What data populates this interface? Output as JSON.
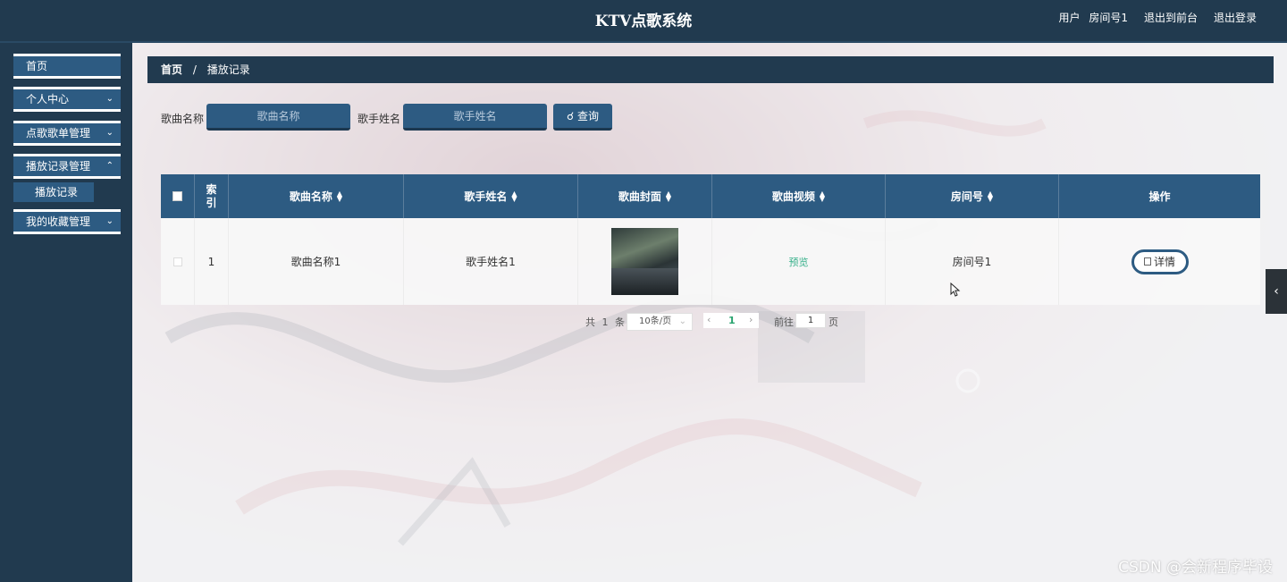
{
  "header": {
    "title": "KTV点歌系统",
    "user_label": "用户",
    "user_name": "房间号1",
    "front_link": "退出到前台",
    "logout_link": "退出登录"
  },
  "sidebar": {
    "items": [
      {
        "label": "首页"
      },
      {
        "label": "个人中心"
      },
      {
        "label": "点歌歌单管理"
      },
      {
        "label": "播放记录管理"
      },
      {
        "label": "我的收藏管理"
      }
    ],
    "subitem": {
      "label": "播放记录"
    }
  },
  "breadcrumb": {
    "home": "首页",
    "sep": "/",
    "current": "播放记录"
  },
  "search": {
    "song_label": "歌曲名称",
    "song_placeholder": "歌曲名称",
    "singer_label": "歌手姓名",
    "singer_placeholder": "歌手姓名",
    "query_label": "查询"
  },
  "table": {
    "headers": {
      "index": "索引",
      "song": "歌曲名称",
      "singer": "歌手姓名",
      "cover": "歌曲封面",
      "video": "歌曲视频",
      "room": "房间号",
      "action": "操作"
    },
    "rows": [
      {
        "index": "1",
        "song": "歌曲名称1",
        "singer": "歌手姓名1",
        "video": "预览",
        "room": "房间号1",
        "action": "详情"
      }
    ]
  },
  "pagination": {
    "total_prefix": "共",
    "total": "1",
    "total_suffix": "条",
    "page_size": "10条/页",
    "current_page": "1",
    "goto_label": "前往",
    "goto_value": "1",
    "goto_suffix": "页"
  },
  "watermark": "CSDN @会新程序毕设",
  "colors": {
    "header_bg": "#213a4f",
    "accent": "#2d5b82",
    "link_green": "#37b08a"
  }
}
